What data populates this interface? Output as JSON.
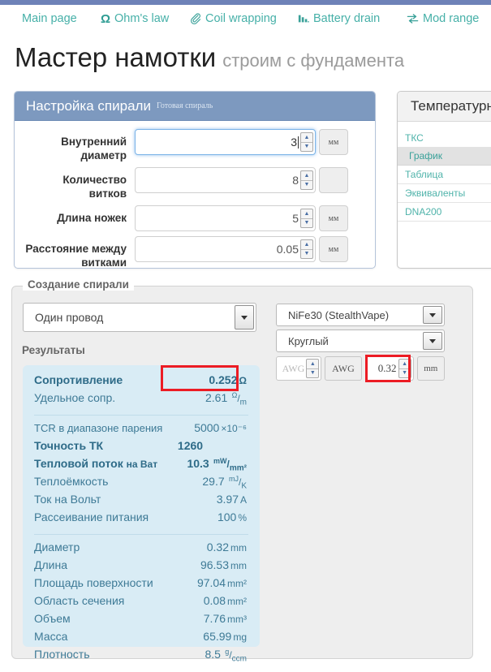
{
  "nav": {
    "items": [
      {
        "label": "Main page",
        "icon": ""
      },
      {
        "label": "Ohm's law",
        "icon": "omega-icon"
      },
      {
        "label": "Coil wrapping",
        "icon": "paperclip-icon"
      },
      {
        "label": "Battery drain",
        "icon": "bar-chart-icon"
      },
      {
        "label": "Mod range",
        "icon": "exchange-arrows-icon"
      }
    ]
  },
  "page": {
    "title": "Мастер намотки",
    "subtitle": "строим с фундамента"
  },
  "coil_panel": {
    "title": "Настройка спирали",
    "subtitle": "Готовая спираль",
    "fields": [
      {
        "label": "Внутренний диаметр",
        "value": "3",
        "unit": "мм",
        "focused": true
      },
      {
        "label": "Количество витков",
        "value": "8",
        "unit": "",
        "focused": false
      },
      {
        "label": "Длина ножек",
        "value": "5",
        "unit": "мм",
        "focused": false
      },
      {
        "label": "Расстояние между витками",
        "value": "0.05",
        "unit": "мм",
        "focused": false
      }
    ]
  },
  "temp_panel": {
    "title": "Температурн",
    "items": [
      {
        "label": "ТКС",
        "active": false
      },
      {
        "label": "График",
        "active": true
      },
      {
        "label": "Таблица",
        "active": false
      },
      {
        "label": "Эквиваленты",
        "active": false
      },
      {
        "label": "DNA200",
        "active": false
      }
    ]
  },
  "builder": {
    "legend": "Создание спирали",
    "wire_type": "Один провод",
    "material": "NiFe30 (StealthVape)",
    "shape": "Круглый",
    "results_title": "Результаты",
    "awg": {
      "placeholder": "AWG",
      "label": "AWG",
      "diameter_value": "0.32",
      "diameter_unit": "mm"
    }
  },
  "results": {
    "group1": [
      {
        "label": "Сопротивление",
        "value": "0.252",
        "unit": "Ω",
        "bold": true
      },
      {
        "label": "Удельное сопр.",
        "value": "2.61",
        "unit": "Ω/m",
        "unit_num": "Ω",
        "unit_den": "m",
        "bold": false
      }
    ],
    "group2": [
      {
        "label": "TCR в диапазоне парения",
        "value": "5000",
        "unit": "×10⁻⁶",
        "bold": false
      },
      {
        "label": "Точность ТК",
        "value": "1260",
        "unit": "",
        "bold": true
      },
      {
        "label": "Тепловой поток",
        "label_light": "на Ват",
        "value": "10.3",
        "unit": "mW/mm²",
        "unit_num": "mW",
        "unit_den": "mm²",
        "bold": true
      },
      {
        "label": "Теплоёмкость",
        "value": "29.7",
        "unit": "mJ/K",
        "unit_num": "mJ",
        "unit_den": "K",
        "bold": false
      },
      {
        "label": "Ток на Вольт",
        "value": "3.97",
        "unit": "A",
        "bold": false
      },
      {
        "label": "Рассеивание питания",
        "value": "100",
        "unit": "%",
        "bold": false
      }
    ],
    "group3": [
      {
        "label": "Диаметр",
        "value": "0.32",
        "unit": "mm"
      },
      {
        "label": "Длина",
        "value": "96.53",
        "unit": "mm"
      },
      {
        "label": "Площадь поверхности",
        "value": "97.04",
        "unit": "mm²"
      },
      {
        "label": "Область сечения",
        "value": "0.08",
        "unit": "mm²"
      },
      {
        "label": "Объем",
        "value": "7.76",
        "unit": "mm³"
      },
      {
        "label": "Масса",
        "value": "65.99",
        "unit": "mg"
      },
      {
        "label": "Плотность",
        "value": "8.5",
        "unit": "g/ccm",
        "unit_num": "g",
        "unit_den": "ccm"
      }
    ]
  },
  "colors": {
    "topbar": "#6e82b8",
    "nav_link": "#46b0a8",
    "panel_header": "#7d99bf",
    "results_bg": "#d9ecf5",
    "results_text": "#3e7a96",
    "highlight": "#ec1c24"
  }
}
